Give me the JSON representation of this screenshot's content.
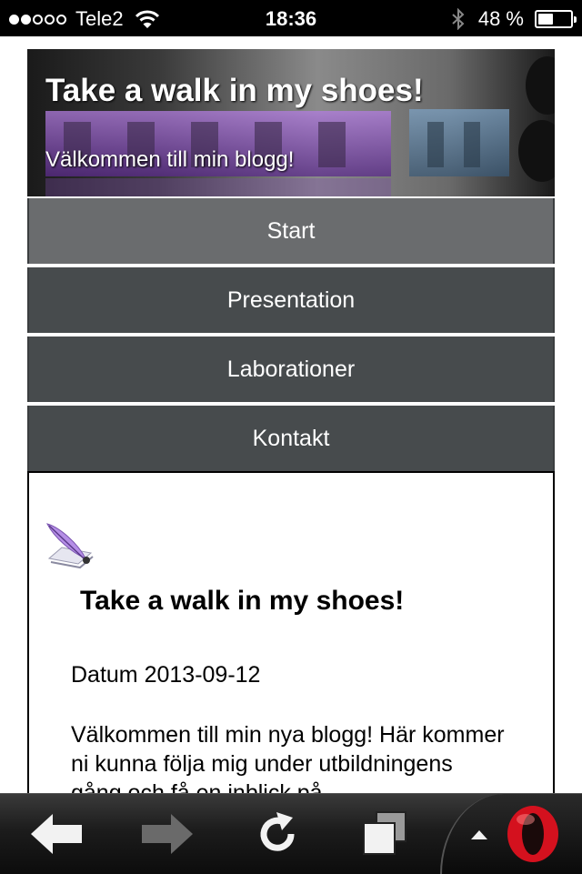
{
  "status_bar": {
    "carrier": "Tele2",
    "time": "18:36",
    "battery_text": "48 %",
    "battery_level": 0.48,
    "signal_bars": 2
  },
  "header": {
    "title": "Take a walk in my shoes!",
    "subtitle": "Välkommen till min blogg!"
  },
  "nav": {
    "items": [
      {
        "label": "Start",
        "active": true
      },
      {
        "label": "Presentation",
        "active": false
      },
      {
        "label": "Laborationer",
        "active": false
      },
      {
        "label": "Kontakt",
        "active": false
      }
    ]
  },
  "post": {
    "icon": "quill-pen-icon",
    "title": "Take a walk in my shoes!",
    "date": "Datum 2013-09-12",
    "body": "Välkommen till min nya blogg! Här kommer ni kunna följa mig under utbildningens gång och få en inblick på"
  },
  "toolbar": {
    "icons": [
      "back-arrow-icon",
      "forward-arrow-icon",
      "reload-icon",
      "tabs-icon",
      "menu-up-icon",
      "opera-logo-icon"
    ]
  },
  "colors": {
    "nav_bg": "#474b4d",
    "nav_active_bg": "#6a6c6e",
    "opera_red": "#d4111e"
  }
}
